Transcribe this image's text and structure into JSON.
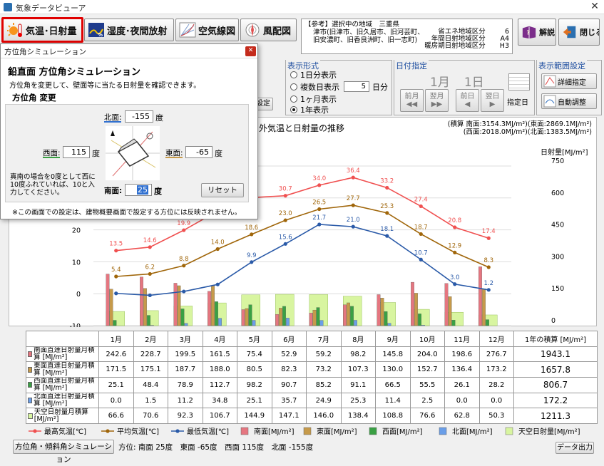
{
  "window": {
    "title": "気象データビューア"
  },
  "toolbar": {
    "temp": "気温･日射量",
    "humid": "湿度･夜間放射",
    "aero": "空気線図",
    "wind": "風配図",
    "help": "解説",
    "close": "閉じる"
  },
  "ref": {
    "line1": "【参考】選択中の地域　三重県",
    "line2": "津市(旧津市、旧久居市、旧河芸町、",
    "line3": "旧安濃町、旧香良洲町、旧一志町)",
    "r_labels": [
      "省エネ地域区分",
      "年間日射地域区分",
      "暖房期日射地域区分"
    ],
    "r_values": [
      "6",
      "A4",
      "H3"
    ]
  },
  "display": {
    "title": "表示形式",
    "opt1": "1日分表示",
    "opt2": "複数日表示",
    "days": "5",
    "days_unit": "日分",
    "opt3": "1ヶ月表示",
    "opt4": "1年表示",
    "selected": "1年表示",
    "hidden_btn": "設定"
  },
  "date": {
    "title": "日付指定",
    "month": "1月",
    "day": "1日",
    "prev_month": "前月",
    "next_month": "翌月",
    "prev_day": "前日",
    "next_day": "翌日",
    "set": "指定日"
  },
  "range": {
    "title": "表示範囲設定",
    "detail": "詳細指定",
    "auto": "自動調整"
  },
  "chart_data": {
    "type": "bar",
    "title": "外気温と日射量の推移",
    "ylabel_right": "日射量[MJ/m²]",
    "totals_line1": "(積算 南面:3154.3MJ/m²)(東面:2869.1MJ/m²)",
    "totals_line2": "(西面:2018.0MJ/m²)(北面:1383.5MJ/m²)",
    "ylim_left": [
      -10,
      40
    ],
    "ylim_right": [
      0,
      750
    ],
    "yticks_left": [
      -10,
      0,
      10,
      20
    ],
    "yticks_right": [
      0,
      150,
      300,
      450,
      600,
      750
    ],
    "categories": [
      "1月",
      "2月",
      "3月",
      "4月",
      "5月",
      "6月",
      "7月",
      "8月",
      "9月",
      "10月",
      "11月",
      "12月"
    ],
    "lines": [
      {
        "name": "最高気温[℃]",
        "color": "#f05050",
        "values": [
          13.5,
          14.6,
          19.9,
          25.9,
          30.1,
          30.7,
          34.0,
          36.4,
          33.2,
          27.4,
          20.8,
          17.4
        ],
        "labels": [
          "13.5",
          "14.6",
          "19.9",
          "",
          "",
          "30.7",
          "34.0",
          "36.4",
          "33.2",
          "27.4",
          "20.8",
          "17.4"
        ]
      },
      {
        "name": "平均気温[℃]",
        "color": "#a0660a",
        "values": [
          5.4,
          6.2,
          8.8,
          14.0,
          18.6,
          23.0,
          26.5,
          27.7,
          25.3,
          18.7,
          12.9,
          8.3
        ],
        "labels": [
          "5.4",
          "6.2",
          "8.8",
          "14.0",
          "18.6",
          "23.0",
          "26.5",
          "27.7",
          "25.3",
          "18.7",
          "12.9",
          "8.3"
        ]
      },
      {
        "name": "最低気温[℃]",
        "color": "#2a5aa8",
        "values": [
          0.1,
          -0.5,
          0.7,
          2.9,
          9.9,
          15.6,
          21.7,
          21.0,
          18.1,
          10.7,
          3.0,
          1.2
        ],
        "labels": [
          "",
          "",
          "",
          "",
          "9.9",
          "15.6",
          "21.7",
          "21.0",
          "18.1",
          "10.7",
          "3.0",
          "1.2"
        ]
      }
    ],
    "series": [
      {
        "name": "南面[MJ/m²]",
        "color": "#e57680",
        "values": [
          242.6,
          228.7,
          199.5,
          161.5,
          75.4,
          52.9,
          59.2,
          98.2,
          145.8,
          204.0,
          198.6,
          276.7
        ]
      },
      {
        "name": "東面[MJ/m²]",
        "color": "#c69a4a",
        "values": [
          171.5,
          175.1,
          187.7,
          188.0,
          80.5,
          82.3,
          73.2,
          107.3,
          130.0,
          152.7,
          136.4,
          173.2
        ]
      },
      {
        "name": "西面[MJ/m²]",
        "color": "#3aa044",
        "values": [
          25.1,
          48.4,
          78.9,
          112.7,
          98.2,
          90.7,
          85.2,
          91.1,
          66.5,
          55.5,
          26.1,
          28.2
        ]
      },
      {
        "name": "北面[MJ/m²]",
        "color": "#6a9ee8",
        "values": [
          0.0,
          1.5,
          11.2,
          34.8,
          25.1,
          35.7,
          24.9,
          25.3,
          11.4,
          2.5,
          0.0,
          0.0
        ]
      },
      {
        "name": "天空日射量[MJ/m²]",
        "color": "#d8f5a0",
        "values": [
          66.6,
          70.6,
          92.3,
          106.7,
          144.9,
          147.1,
          146.0,
          138.4,
          108.8,
          76.6,
          62.8,
          50.3
        ]
      }
    ]
  },
  "table": {
    "header_total": "1年の積算 [MJ/m²]",
    "rows": [
      {
        "label": "南面直達日射量月積算 [MJ/m²]",
        "color": "#e57680",
        "values": [
          "242.6",
          "228.7",
          "199.5",
          "161.5",
          "75.4",
          "52.9",
          "59.2",
          "98.2",
          "145.8",
          "204.0",
          "198.6",
          "276.7"
        ],
        "total": "1943.1"
      },
      {
        "label": "東面直達日射量月積算 [MJ/m²]",
        "color": "#c69a4a",
        "values": [
          "171.5",
          "175.1",
          "187.7",
          "188.0",
          "80.5",
          "82.3",
          "73.2",
          "107.3",
          "130.0",
          "152.7",
          "136.4",
          "173.2"
        ],
        "total": "1657.8"
      },
      {
        "label": "西面直達日射量月積算 [MJ/m²]",
        "color": "#3aa044",
        "values": [
          "25.1",
          "48.4",
          "78.9",
          "112.7",
          "98.2",
          "90.7",
          "85.2",
          "91.1",
          "66.5",
          "55.5",
          "26.1",
          "28.2"
        ],
        "total": "806.7"
      },
      {
        "label": "北面直達日射量月積算 [MJ/m²]",
        "color": "#6a9ee8",
        "values": [
          "0.0",
          "1.5",
          "11.2",
          "34.8",
          "25.1",
          "35.7",
          "24.9",
          "25.3",
          "11.4",
          "2.5",
          "0.0",
          "0.0"
        ],
        "total": "172.2"
      },
      {
        "label": "天空日射量月積算 [MJ/m²]",
        "color": "#d8f5a0",
        "values": [
          "66.6",
          "70.6",
          "92.3",
          "106.7",
          "144.9",
          "147.1",
          "146.0",
          "138.4",
          "108.8",
          "76.6",
          "62.8",
          "50.3"
        ],
        "total": "1211.3"
      }
    ]
  },
  "legend": [
    "最高気温[℃]",
    "平均気温[℃]",
    "最低気温[℃]",
    "南面[MJ/m²]",
    "東面[MJ/m²]",
    "西面[MJ/m²]",
    "北面[MJ/m²]",
    "天空日射量[MJ/m²]"
  ],
  "bottom": {
    "sim_btn": "方位角・傾斜角シミュレーション",
    "status": "方位: 南面 25度　東面 -65度　西面 115度　北面 -155度",
    "export": "データ出力"
  },
  "dialog": {
    "title": "方位角シミュレーション",
    "heading": "鉛直面 方位角シミュレーション",
    "desc": "方位角を変更して、壁面等に当たる日射量を確認できます。",
    "section": "方位角 変更",
    "north_label": "北面:",
    "north_value": "-155",
    "west_label": "西面:",
    "west_value": "115",
    "east_label": "東面:",
    "east_value": "-65",
    "south_label": "南面:",
    "south_value": "25",
    "deg": "度",
    "hint": "真南の場合を0度として西に10度ふれていれば、10と入力してください。",
    "reset": "リセット",
    "note": "※この画面での設定は、建物概要画面で設定する方位には反映されません。"
  }
}
